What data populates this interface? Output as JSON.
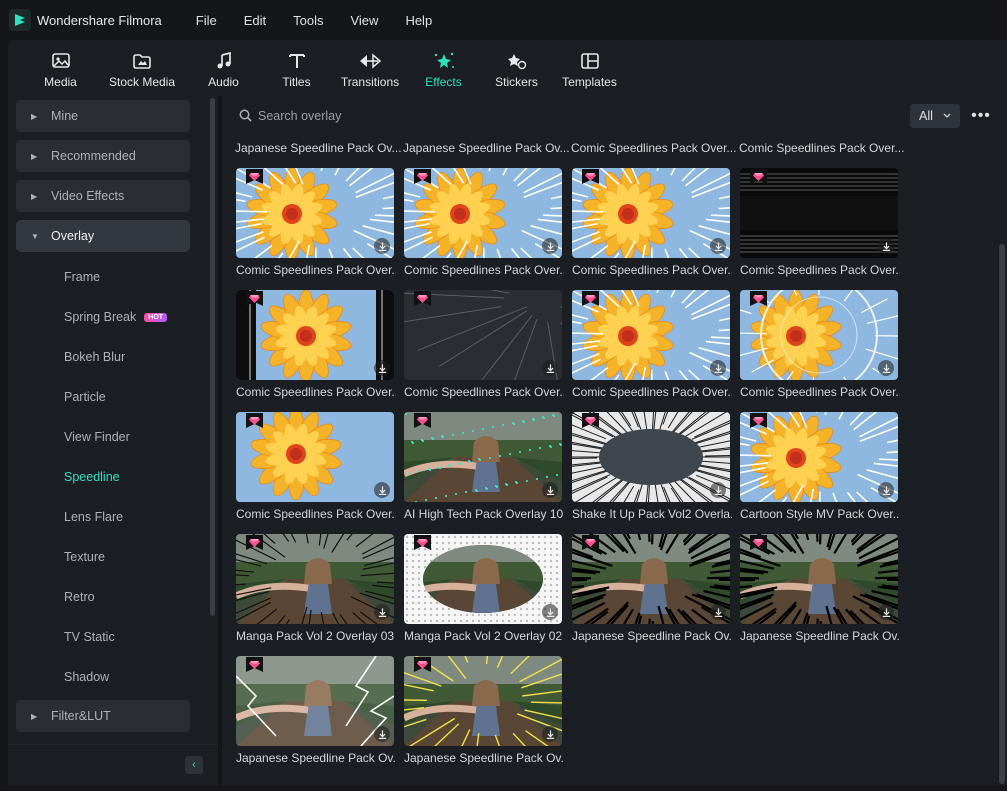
{
  "app": {
    "title": "Wondershare Filmora"
  },
  "menu": [
    "File",
    "Edit",
    "Tools",
    "View",
    "Help"
  ],
  "tabs": [
    {
      "label": "Media",
      "icon": "media-icon"
    },
    {
      "label": "Stock Media",
      "icon": "stock-media-icon"
    },
    {
      "label": "Audio",
      "icon": "audio-icon"
    },
    {
      "label": "Titles",
      "icon": "titles-icon"
    },
    {
      "label": "Transitions",
      "icon": "transitions-icon"
    },
    {
      "label": "Effects",
      "icon": "effects-icon",
      "active": true
    },
    {
      "label": "Stickers",
      "icon": "stickers-icon"
    },
    {
      "label": "Templates",
      "icon": "templates-icon"
    }
  ],
  "sidebar": {
    "categories": {
      "mine": "Mine",
      "recommended": "Recommended",
      "video_effects": "Video Effects",
      "overlay": "Overlay",
      "filter_lut": "Filter&LUT"
    },
    "overlay_items": [
      "Frame",
      "Spring Break",
      "Bokeh Blur",
      "Particle",
      "View Finder",
      "Speedline",
      "Lens Flare",
      "Texture",
      "Retro",
      "TV Static",
      "Shadow"
    ],
    "hot_badge": "HOT",
    "active_item": "Speedline"
  },
  "search": {
    "placeholder": "Search overlay",
    "filter_value": "All"
  },
  "top_row_labels": [
    "Japanese Speedline Pack Ov...",
    "Japanese Speedline Pack Ov...",
    "Comic Speedlines Pack Over...",
    "Comic Speedlines Pack Over..."
  ],
  "items": [
    {
      "label": "Comic Speedlines Pack Over...",
      "thumb": "flower-speedlines"
    },
    {
      "label": "Comic Speedlines Pack Over...",
      "thumb": "flower-speedlines"
    },
    {
      "label": "Comic Speedlines Pack Over...",
      "thumb": "flower-speedlines"
    },
    {
      "label": "Comic Speedlines Pack Over...",
      "thumb": "dark-horizontal-lines"
    },
    {
      "label": "Comic Speedlines Pack Over...",
      "thumb": "flower-dark-frame"
    },
    {
      "label": "Comic Speedlines Pack Over...",
      "thumb": "dark-diagonal-lines"
    },
    {
      "label": "Comic Speedlines Pack Over...",
      "thumb": "flower-speedlines"
    },
    {
      "label": "Comic Speedlines Pack Over...",
      "thumb": "flower-radar-rings"
    },
    {
      "label": "Comic Speedlines Pack Over...",
      "thumb": "flower-plain"
    },
    {
      "label": "AI High Tech Pack Overlay 10",
      "thumb": "girl-tech-particles"
    },
    {
      "label": "Shake It Up Pack Vol2 Overla...",
      "thumb": "gray-burst"
    },
    {
      "label": "Cartoon Style MV Pack Over...",
      "thumb": "flower-speedlines"
    },
    {
      "label": "Manga Pack Vol 2 Overlay 03",
      "thumb": "girl-manga-lines"
    },
    {
      "label": "Manga Pack Vol 2 Overlay 02",
      "thumb": "girl-halftone-oval"
    },
    {
      "label": "Japanese Speedline Pack Ov...",
      "thumb": "girl-black-burst"
    },
    {
      "label": "Japanese Speedline Pack Ov...",
      "thumb": "girl-black-burst"
    },
    {
      "label": "Japanese Speedline Pack Ov...",
      "thumb": "girl-lightning"
    },
    {
      "label": "Japanese Speedline Pack Ov...",
      "thumb": "girl-yellow-lines"
    }
  ],
  "colors": {
    "accent": "#2fe0c0",
    "premium_gem": "#ff4f8f",
    "background": "#1b1e22"
  }
}
